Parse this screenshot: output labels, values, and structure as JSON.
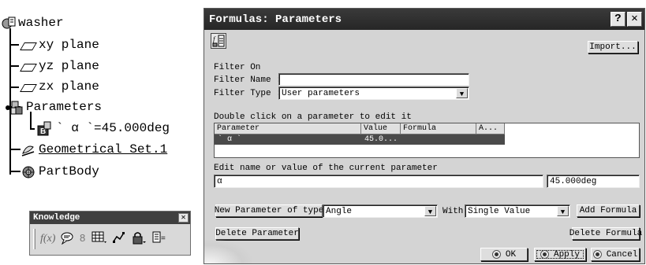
{
  "tree": {
    "root": "washer",
    "items": [
      {
        "label": "xy plane",
        "icon": "plane-icon"
      },
      {
        "label": "yz plane",
        "icon": "plane-icon"
      },
      {
        "label": "zx plane",
        "icon": "plane-icon"
      },
      {
        "label": "Parameters",
        "icon": "parameters-icon"
      },
      {
        "label": "` α `=45.000deg",
        "icon": "angle-parameter-icon"
      },
      {
        "label": "Geometrical Set.1",
        "icon": "geometrical-set-icon"
      },
      {
        "label": "PartBody",
        "icon": "part-body-icon"
      }
    ]
  },
  "knowledge_toolbar": {
    "title": "Knowledge",
    "close": "✕",
    "fog_label": "f(x)"
  },
  "dialog": {
    "title": "Formulas: Parameters",
    "help": "?",
    "close": "✕",
    "import_label": "Import...",
    "filter_on": "Filter On",
    "filter_name_label": "Filter Name :",
    "filter_name_value": "",
    "filter_type_label": "Filter Type :",
    "filter_type_value": "User parameters",
    "double_click_hint": "Double click on a parameter to edit it",
    "table": {
      "headers": [
        "Parameter",
        "Value",
        "Formula",
        "A..."
      ],
      "rows": [
        {
          "parameter": "` α `",
          "value": "45.0...",
          "formula": "",
          "active": ""
        }
      ]
    },
    "edit_label": "Edit name or value of the current parameter",
    "edit_name": "α",
    "edit_value": "45.000deg",
    "new_param_label": "New Parameter of type",
    "new_param_type": "Angle",
    "with_label": "With",
    "with_value": "Single Value",
    "add_formula": "Add Formula",
    "delete_parameter": "Delete Parameter",
    "delete_formula": "Delete Formula",
    "ok": "OK",
    "apply": "Apply",
    "cancel": "Cancel"
  }
}
